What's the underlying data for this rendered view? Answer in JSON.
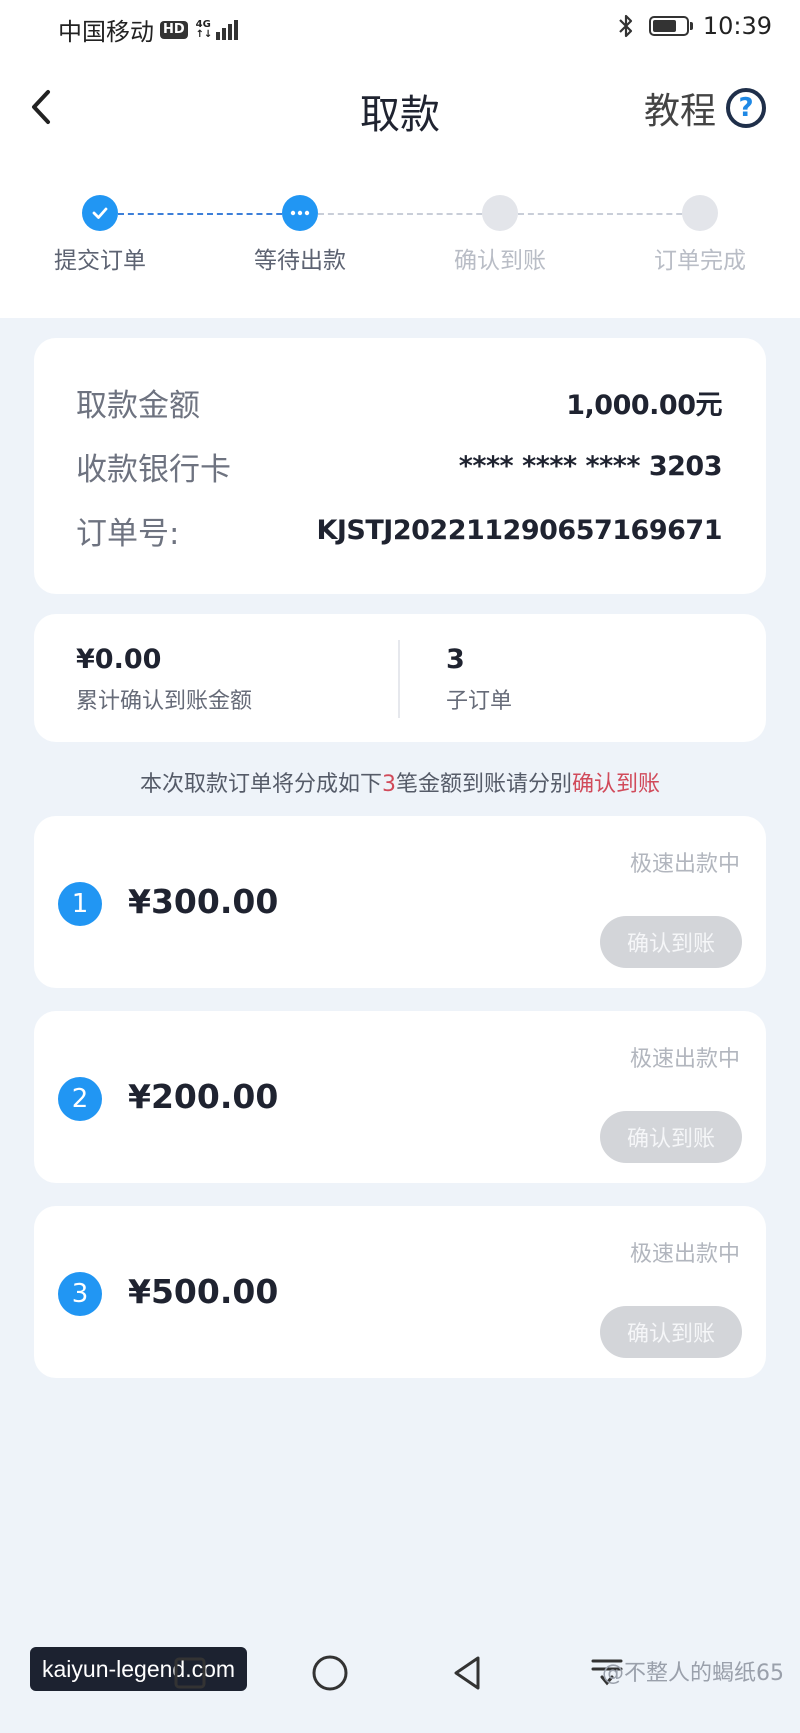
{
  "status_bar": {
    "carrier": "中国移动",
    "hd_badge": "HD",
    "network_top": "4G",
    "network_bottom": "↑↓",
    "time": "10:39",
    "battery_level": 0.75
  },
  "nav": {
    "title": "取款",
    "tutorial_label": "教程",
    "help_glyph": "?"
  },
  "steps": [
    {
      "label": "提交订单",
      "state": "done"
    },
    {
      "label": "等待出款",
      "state": "current"
    },
    {
      "label": "确认到账",
      "state": "pending"
    },
    {
      "label": "订单完成",
      "state": "pending"
    }
  ],
  "info": {
    "amount_label": "取款金额",
    "amount_value": "1,000.00元",
    "card_label": "收款银行卡",
    "card_value": "**** **** **** 3203",
    "order_label": "订单号:",
    "order_value": "KJSTJ202211290657169671"
  },
  "summary": {
    "confirmed_value": "¥0.00",
    "confirmed_label": "累计确认到账金额",
    "sub_count_value": "3",
    "sub_count_label": "子订单"
  },
  "notice": {
    "prefix": "本次取款订单将分成如下",
    "count": "3",
    "middle": "笔金额到账请分别",
    "action": "确认到账"
  },
  "sub_orders": [
    {
      "num": "1",
      "amount": "¥300.00",
      "status": "极速出款中",
      "button": "确认到账"
    },
    {
      "num": "2",
      "amount": "¥200.00",
      "status": "极速出款中",
      "button": "确认到账"
    },
    {
      "num": "3",
      "amount": "¥500.00",
      "status": "极速出款中",
      "button": "确认到账"
    }
  ],
  "bottom": {
    "watermark_left": "kaiyun-legend.com",
    "watermark_right": "@不整人的蝎纸65"
  },
  "colors": {
    "accent": "#2196f3",
    "highlight": "#d14a5a",
    "disabled_button": "#d3d5d9"
  }
}
